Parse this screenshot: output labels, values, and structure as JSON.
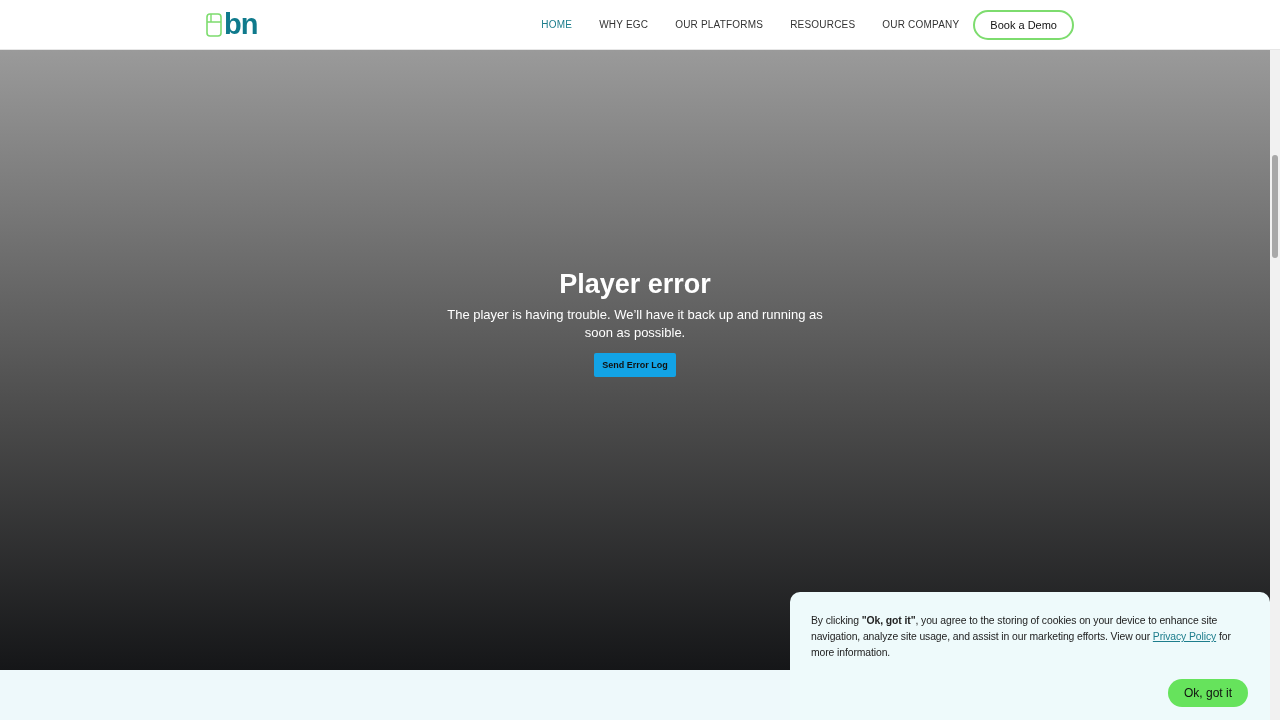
{
  "header": {
    "logo": {
      "text": "bn"
    },
    "nav": [
      {
        "label": "HOME",
        "selected": true
      },
      {
        "label": "WHY EGC",
        "selected": false
      },
      {
        "label": "OUR PLATFORMS",
        "selected": false
      },
      {
        "label": "RESOURCES",
        "selected": false
      },
      {
        "label": "OUR COMPANY",
        "selected": false
      }
    ],
    "cta": "Book a Demo"
  },
  "player": {
    "title": "Player error",
    "message": "The player is having trouble. We’ll have it back up and running as soon as possible.",
    "button": "Send Error Log"
  },
  "cookie_banner": {
    "text_before": "By clicking **\"Ok, got it\"**, you agree to the storing of cookies on your device to enhance site navigation, analyze site usage, and assist in our marketing efforts. View our ",
    "link": "Privacy Policy",
    "text_after": " for more information.",
    "button": "Ok, got it"
  }
}
